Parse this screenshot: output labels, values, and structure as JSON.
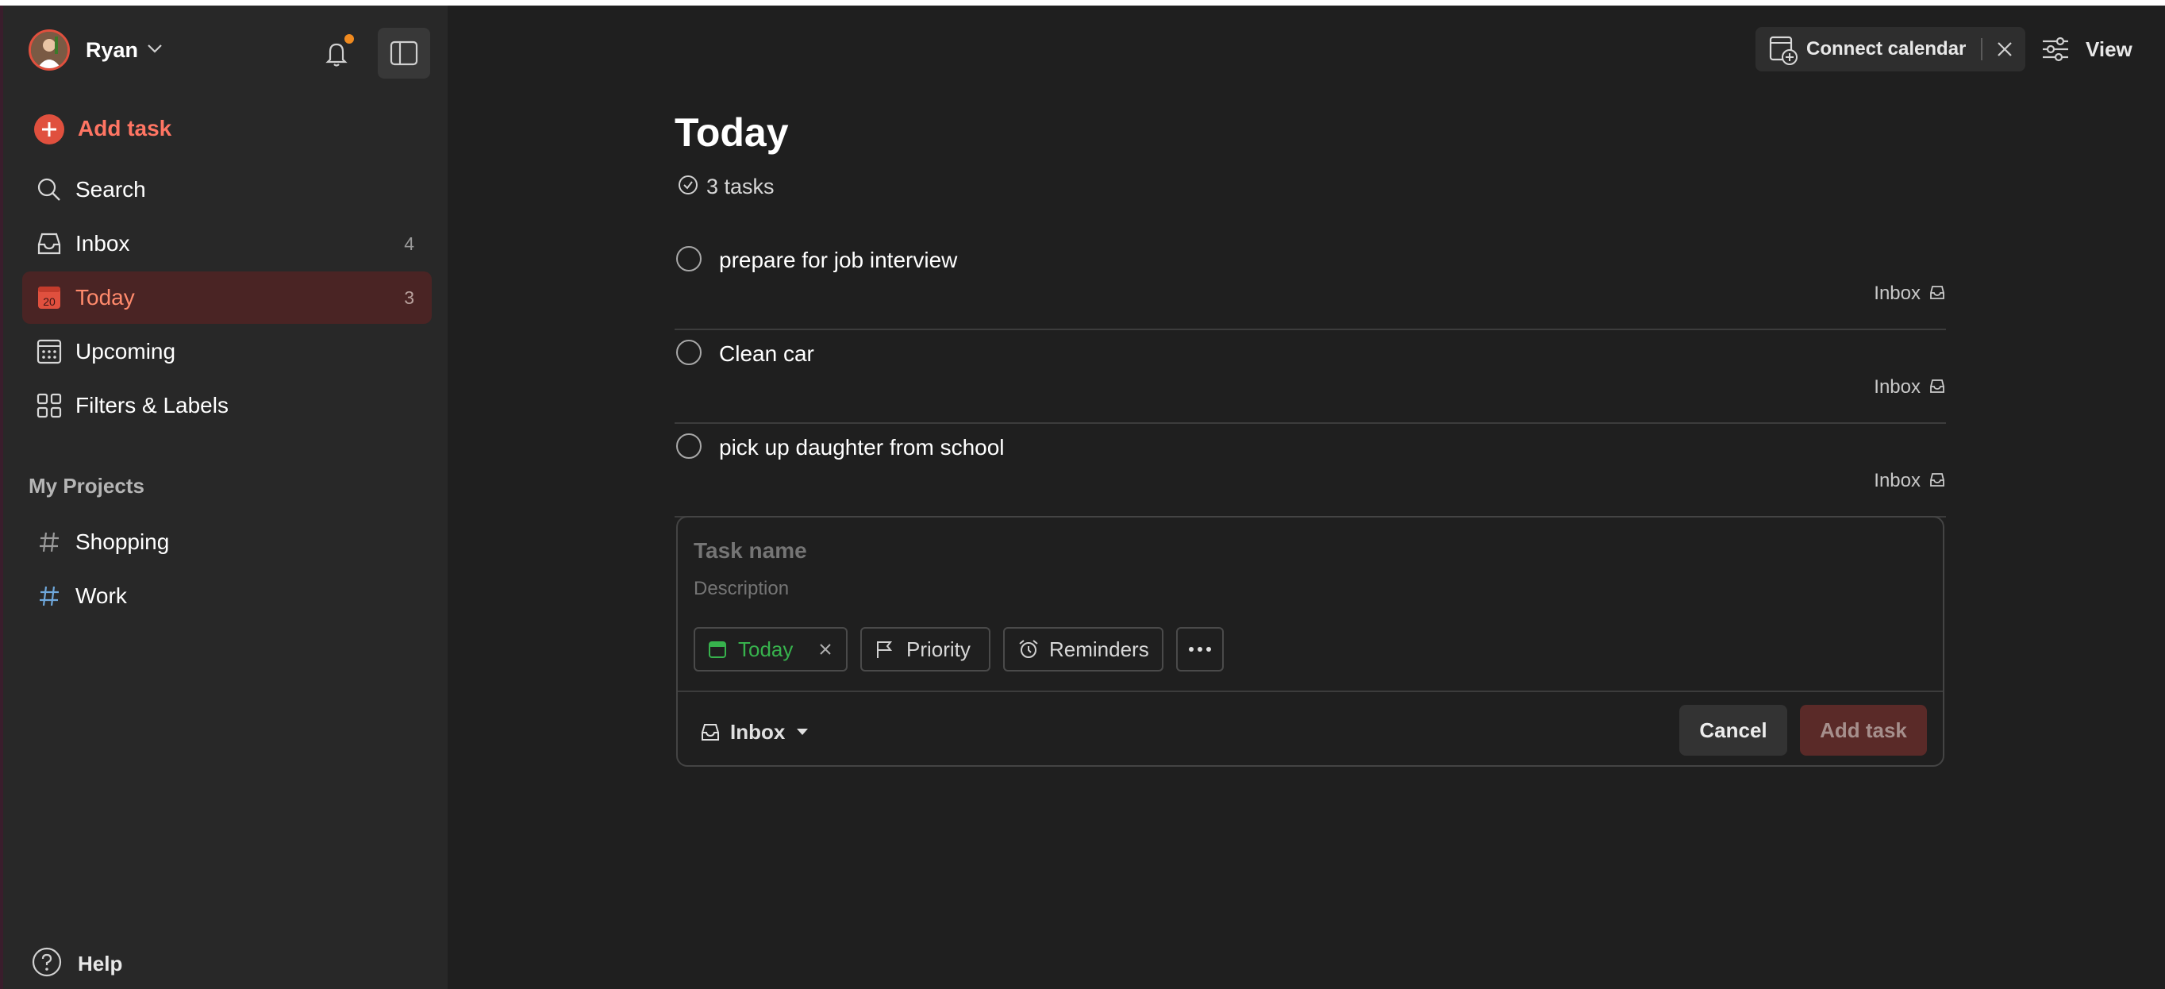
{
  "user": {
    "name": "Ryan"
  },
  "sidebar": {
    "add_task": "Add task",
    "items": [
      {
        "label": "Search",
        "count": ""
      },
      {
        "label": "Inbox",
        "count": "4"
      },
      {
        "label": "Today",
        "count": "3"
      },
      {
        "label": "Upcoming",
        "count": ""
      },
      {
        "label": "Filters & Labels",
        "count": ""
      }
    ],
    "today_icon_number": "20",
    "projects_title": "My Projects",
    "projects": [
      {
        "label": "Shopping"
      },
      {
        "label": "Work"
      }
    ],
    "help": "Help"
  },
  "header": {
    "connect_calendar": "Connect calendar",
    "view": "View"
  },
  "main": {
    "title": "Today",
    "task_count": "3 tasks",
    "tasks": [
      {
        "title": "prepare for job interview",
        "project": "Inbox"
      },
      {
        "title": "Clean car",
        "project": "Inbox"
      },
      {
        "title": "pick up daughter from school",
        "project": "Inbox"
      }
    ]
  },
  "editor": {
    "name_placeholder": "Task name",
    "description_placeholder": "Description",
    "chips": {
      "date": "Today",
      "priority": "Priority",
      "reminders": "Reminders"
    },
    "project": "Inbox",
    "cancel": "Cancel",
    "submit": "Add task"
  },
  "colors": {
    "accent": "#e0503e",
    "today_green": "#37b24d",
    "notification": "#f08a1f"
  }
}
